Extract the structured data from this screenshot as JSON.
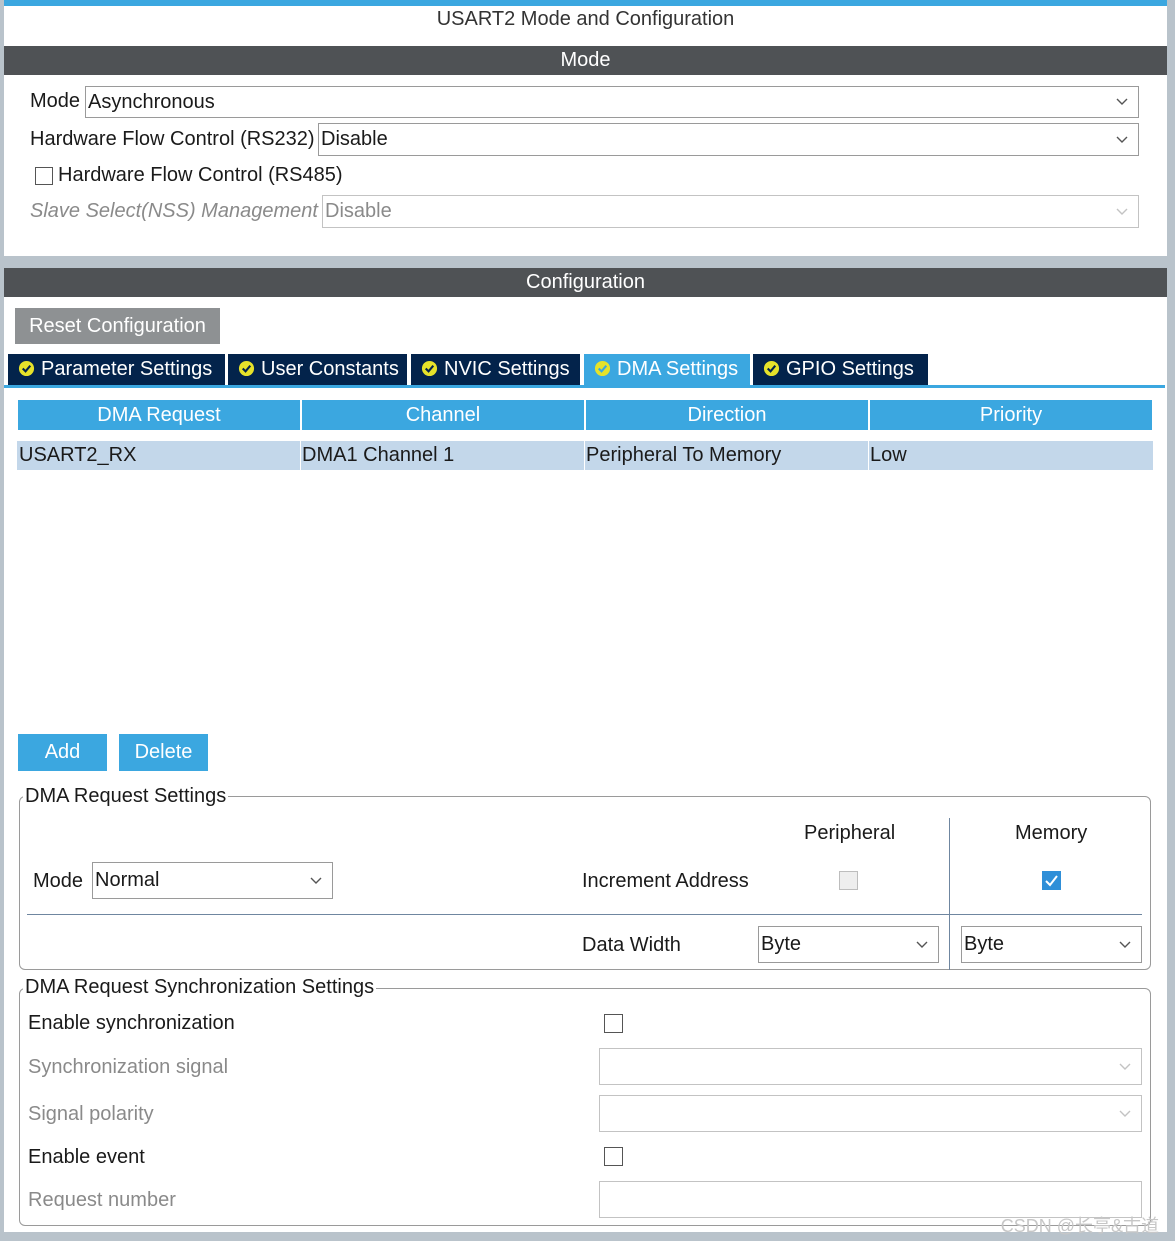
{
  "window": {
    "title": "USART2 Mode and Configuration"
  },
  "mode_section": {
    "header": "Mode",
    "mode": {
      "label": "Mode",
      "value": "Asynchronous"
    },
    "hw_flow_rs232": {
      "label": "Hardware Flow Control (RS232)",
      "value": "Disable"
    },
    "hw_flow_rs485": {
      "label": "Hardware Flow Control (RS485)",
      "checked": false
    },
    "slave_select": {
      "label": "Slave Select(NSS) Management",
      "value": "Disable",
      "disabled": true
    }
  },
  "config_section": {
    "header": "Configuration",
    "reset_label": "Reset Configuration",
    "tabs": [
      {
        "label": "Parameter Settings",
        "active": false
      },
      {
        "label": "User Constants",
        "active": false
      },
      {
        "label": "NVIC Settings",
        "active": false
      },
      {
        "label": "DMA Settings",
        "active": true
      },
      {
        "label": "GPIO Settings",
        "active": false
      }
    ]
  },
  "dma_table": {
    "columns": [
      "DMA Request",
      "Channel",
      "Direction",
      "Priority"
    ],
    "rows": [
      [
        "USART2_RX",
        "DMA1 Channel 1",
        "Peripheral To Memory",
        "Low"
      ]
    ]
  },
  "buttons": {
    "add": "Add",
    "delete": "Delete"
  },
  "dma_request_settings": {
    "title": "DMA Request Settings",
    "mode_label": "Mode",
    "mode_value": "Normal",
    "peripheral_header": "Peripheral",
    "memory_header": "Memory",
    "increment_label": "Increment Address",
    "peripheral_increment": false,
    "memory_increment": true,
    "data_width_label": "Data Width",
    "peripheral_width": "Byte",
    "memory_width": "Byte"
  },
  "sync_settings": {
    "title": "DMA Request Synchronization Settings",
    "enable_sync_label": "Enable synchronization",
    "enable_sync": false,
    "sync_signal_label": "Synchronization signal",
    "sync_signal_value": "",
    "signal_polarity_label": "Signal polarity",
    "signal_polarity_value": "",
    "enable_event_label": "Enable event",
    "enable_event": false,
    "request_number_label": "Request number",
    "request_number_value": ""
  },
  "watermark": "CSDN @长亭&古道",
  "colors": {
    "accent": "#3ba7e0",
    "tab_dark": "#03234b",
    "header_gray": "#4f5255",
    "row_selected": "#c3d7ea"
  }
}
